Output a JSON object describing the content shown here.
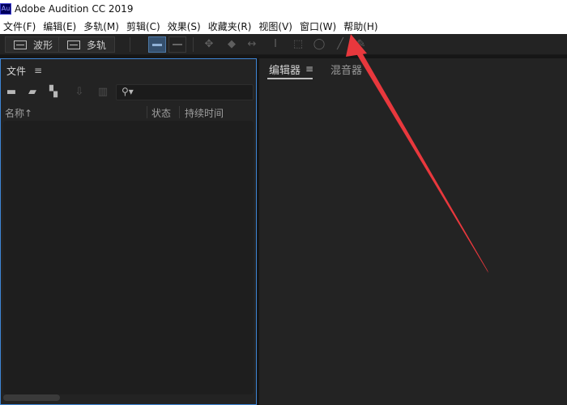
{
  "window": {
    "app_icon_text": "Au",
    "title": "Adobe Audition CC 2019"
  },
  "menu": {
    "items": [
      "文件(F)",
      "编辑(E)",
      "多轨(M)",
      "剪辑(C)",
      "效果(S)",
      "收藏夹(R)",
      "视图(V)",
      "窗口(W)",
      "帮助(H)"
    ]
  },
  "toolbar": {
    "waveform_label": "波形",
    "multitrack_label": "多轨"
  },
  "files_panel": {
    "title": "文件",
    "menu_icon": "≡",
    "search_placeholder": "",
    "columns": {
      "name": "名称",
      "sort_indicator": "↑",
      "status": "状态",
      "duration": "持续时间"
    }
  },
  "editor_panel": {
    "tabs": [
      "编辑器",
      "混音器"
    ],
    "menu_icon": "≡"
  },
  "annotation": {
    "arrow_color": "#e8383d"
  },
  "colors": {
    "active_blue": "#3e86d6",
    "arrow_red": "#e8383d"
  }
}
